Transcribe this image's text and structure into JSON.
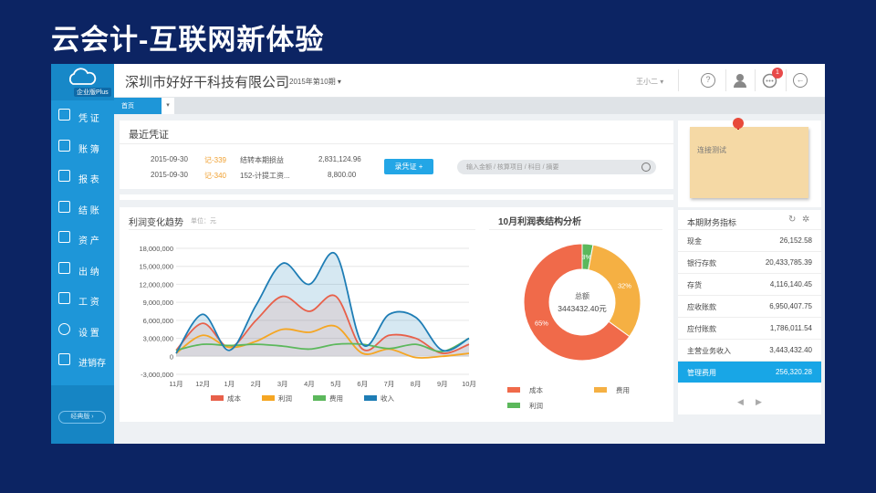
{
  "slide_title": "云会计-互联网新体验",
  "app": {
    "logo_badge": "企业版Plus",
    "company_name": "深圳市好好干科技有限公司",
    "period": "2015年第10期 ▾",
    "user": "王小二 ▾",
    "notification_count": "1",
    "help_glyph": "?",
    "back_glyph": "←"
  },
  "sidebar": {
    "items": [
      {
        "label": "凭 证",
        "icon": "edit-icon"
      },
      {
        "label": "账 簿",
        "icon": "book-icon"
      },
      {
        "label": "报 表",
        "icon": "report-icon"
      },
      {
        "label": "结 账",
        "icon": "checkout-icon"
      },
      {
        "label": "资 产",
        "icon": "asset-icon"
      },
      {
        "label": "出 纳",
        "icon": "cashier-icon"
      },
      {
        "label": "工 资",
        "icon": "salary-icon"
      },
      {
        "label": "设 置",
        "icon": "gear-icon"
      },
      {
        "label": "进销存",
        "icon": "inventory-icon"
      }
    ],
    "bottom_button": "经典版 ›"
  },
  "tabs": {
    "home": "首页",
    "dropdown": "▾"
  },
  "recent_vouchers": {
    "title": "最近凭证",
    "rows": [
      {
        "date": "2015-09-30",
        "no": "记-339",
        "summary": "结转本期损益",
        "amount": "2,831,124.96"
      },
      {
        "date": "2015-09-30",
        "no": "记-340",
        "summary": "152-计提工资...",
        "amount": "8,800.00"
      }
    ],
    "add_button": "录凭证 +",
    "search_placeholder": "输入金额 / 核算项目 / 科目 / 摘要"
  },
  "sticky_note": {
    "text": "连接测试"
  },
  "trend_chart": {
    "title": "利润变化趋势",
    "unit": "单位：元"
  },
  "pie_chart": {
    "title": "10月利润表结构分析",
    "center_label": "总额",
    "center_value": "3443432.40元"
  },
  "stats": {
    "title": "本期财务指标",
    "refresh_glyph": "↻",
    "settings_glyph": "✲",
    "rows": [
      {
        "label": "现金",
        "value": "26,152.58"
      },
      {
        "label": "银行存款",
        "value": "20,433,785.39"
      },
      {
        "label": "存货",
        "value": "4,116,140.45"
      },
      {
        "label": "应收账款",
        "value": "6,950,407.75"
      },
      {
        "label": "应付账款",
        "value": "1,786,011.54"
      },
      {
        "label": "主营业务收入",
        "value": "3,443,432.40"
      },
      {
        "label": "管理费用",
        "value": "256,320.28"
      }
    ],
    "prev": "◀",
    "next": "▶"
  },
  "chart_data": [
    {
      "type": "area",
      "title": "利润变化趋势",
      "ylabel": "单位：元",
      "categories": [
        "11月",
        "12月",
        "1月",
        "2月",
        "3月",
        "4月",
        "5月",
        "6月",
        "7月",
        "8月",
        "9月",
        "10月"
      ],
      "ylim": [
        -3000000,
        18000000
      ],
      "yticks": [
        "18,000,000",
        "15,000,000",
        "12,000,000",
        "9,000,000",
        "6,000,000",
        "3,000,000",
        "0",
        "-3,000,000"
      ],
      "ytick_values": [
        18000000,
        15000000,
        12000000,
        9000000,
        6000000,
        3000000,
        0,
        -3000000
      ],
      "grid": true,
      "legend": "bottom",
      "series": [
        {
          "name": "成本",
          "color": "#e8604a",
          "values": [
            1000000,
            5500000,
            1500000,
            6000000,
            10000000,
            7500000,
            10000000,
            1200000,
            3500000,
            3000000,
            500000,
            2000000
          ]
        },
        {
          "name": "利润",
          "color": "#f5a623",
          "values": [
            500000,
            3500000,
            1500000,
            2500000,
            4500000,
            4000000,
            5000000,
            500000,
            1200000,
            -200000,
            0,
            500000
          ]
        },
        {
          "name": "费用",
          "color": "#5cb85c",
          "values": [
            1000000,
            2000000,
            1800000,
            2000000,
            1700000,
            1200000,
            2000000,
            2000000,
            1300000,
            2000000,
            800000,
            3000000
          ]
        },
        {
          "name": "收入",
          "color": "#1e7db5",
          "values": [
            500000,
            7000000,
            1000000,
            8500000,
            15500000,
            12000000,
            17000000,
            2000000,
            7000000,
            6500000,
            1000000,
            3000000
          ]
        }
      ]
    },
    {
      "type": "pie",
      "title": "10月利润表结构分析",
      "legend": "bottom",
      "slices": [
        {
          "name": "成本",
          "value": 65,
          "label": "65%",
          "color": "#f06a4a"
        },
        {
          "name": "费用",
          "value": 32,
          "label": "32%",
          "color": "#f5b043"
        },
        {
          "name": "利润",
          "value": 3,
          "label": "3%",
          "color": "#5cb85c"
        }
      ]
    }
  ]
}
